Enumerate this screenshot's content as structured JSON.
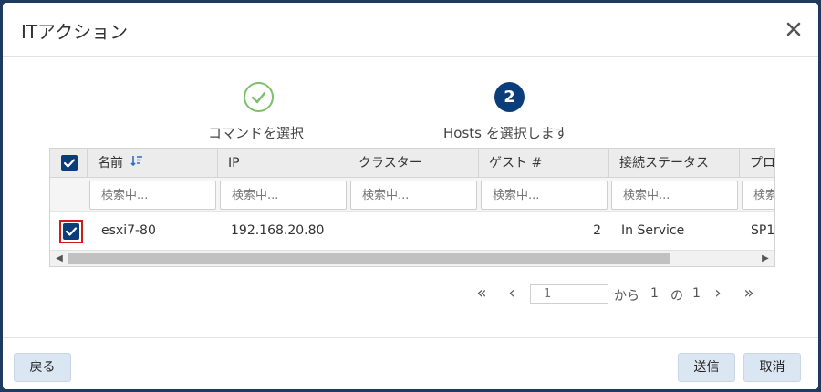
{
  "dialog": {
    "title": "ITアクション"
  },
  "stepper": {
    "steps": [
      {
        "label": "コマンドを選択",
        "state": "done"
      },
      {
        "label": "Hosts を選択します",
        "number": "2",
        "state": "active"
      }
    ]
  },
  "grid": {
    "columns": [
      "名前",
      "IP",
      "クラスター",
      "ゲスト #",
      "接続ステータス",
      "プロ"
    ],
    "filter_placeholder": "検索中...",
    "filter_placeholder_cut": "検索",
    "rows": [
      {
        "name": "esxi7-80",
        "ip": "192.168.20.80",
        "cluster": "",
        "guests": "2",
        "status": "In Service",
        "extra": "SP1"
      }
    ]
  },
  "pager": {
    "page": "1",
    "from_text": "から",
    "current": "1",
    "of_text": "の",
    "total": "1"
  },
  "footer": {
    "back_label": "戻る",
    "send_label": "送信",
    "cancel_label": "取消"
  },
  "colors": {
    "accent": "#0b3d7a",
    "success": "#7bbf6a",
    "highlight": "#d11b1b"
  }
}
